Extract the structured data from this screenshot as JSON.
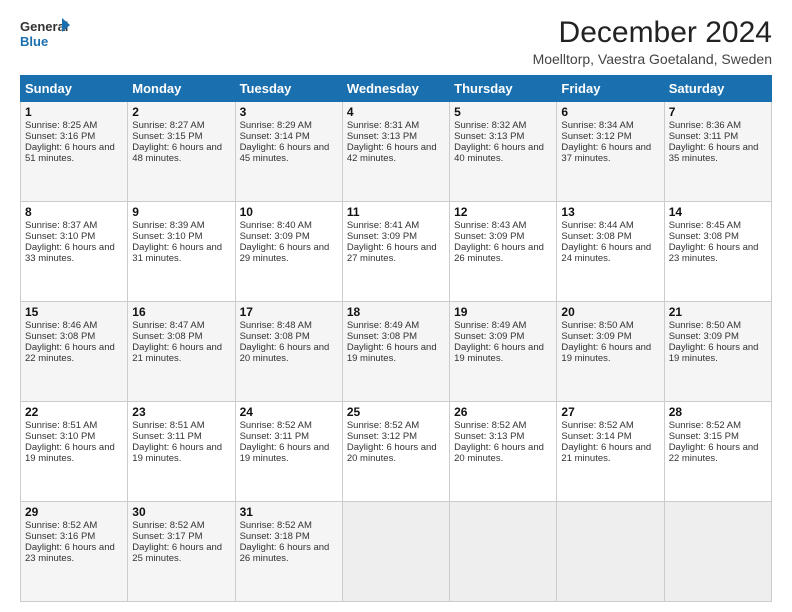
{
  "logo": {
    "line1": "General",
    "line2": "Blue"
  },
  "title": "December 2024",
  "subtitle": "Moelltorp, Vaestra Goetaland, Sweden",
  "days_header": [
    "Sunday",
    "Monday",
    "Tuesday",
    "Wednesday",
    "Thursday",
    "Friday",
    "Saturday"
  ],
  "weeks": [
    [
      {
        "day": "1",
        "sunrise": "Sunrise: 8:25 AM",
        "sunset": "Sunset: 3:16 PM",
        "daylight": "Daylight: 6 hours and 51 minutes."
      },
      {
        "day": "2",
        "sunrise": "Sunrise: 8:27 AM",
        "sunset": "Sunset: 3:15 PM",
        "daylight": "Daylight: 6 hours and 48 minutes."
      },
      {
        "day": "3",
        "sunrise": "Sunrise: 8:29 AM",
        "sunset": "Sunset: 3:14 PM",
        "daylight": "Daylight: 6 hours and 45 minutes."
      },
      {
        "day": "4",
        "sunrise": "Sunrise: 8:31 AM",
        "sunset": "Sunset: 3:13 PM",
        "daylight": "Daylight: 6 hours and 42 minutes."
      },
      {
        "day": "5",
        "sunrise": "Sunrise: 8:32 AM",
        "sunset": "Sunset: 3:13 PM",
        "daylight": "Daylight: 6 hours and 40 minutes."
      },
      {
        "day": "6",
        "sunrise": "Sunrise: 8:34 AM",
        "sunset": "Sunset: 3:12 PM",
        "daylight": "Daylight: 6 hours and 37 minutes."
      },
      {
        "day": "7",
        "sunrise": "Sunrise: 8:36 AM",
        "sunset": "Sunset: 3:11 PM",
        "daylight": "Daylight: 6 hours and 35 minutes."
      }
    ],
    [
      {
        "day": "8",
        "sunrise": "Sunrise: 8:37 AM",
        "sunset": "Sunset: 3:10 PM",
        "daylight": "Daylight: 6 hours and 33 minutes."
      },
      {
        "day": "9",
        "sunrise": "Sunrise: 8:39 AM",
        "sunset": "Sunset: 3:10 PM",
        "daylight": "Daylight: 6 hours and 31 minutes."
      },
      {
        "day": "10",
        "sunrise": "Sunrise: 8:40 AM",
        "sunset": "Sunset: 3:09 PM",
        "daylight": "Daylight: 6 hours and 29 minutes."
      },
      {
        "day": "11",
        "sunrise": "Sunrise: 8:41 AM",
        "sunset": "Sunset: 3:09 PM",
        "daylight": "Daylight: 6 hours and 27 minutes."
      },
      {
        "day": "12",
        "sunrise": "Sunrise: 8:43 AM",
        "sunset": "Sunset: 3:09 PM",
        "daylight": "Daylight: 6 hours and 26 minutes."
      },
      {
        "day": "13",
        "sunrise": "Sunrise: 8:44 AM",
        "sunset": "Sunset: 3:08 PM",
        "daylight": "Daylight: 6 hours and 24 minutes."
      },
      {
        "day": "14",
        "sunrise": "Sunrise: 8:45 AM",
        "sunset": "Sunset: 3:08 PM",
        "daylight": "Daylight: 6 hours and 23 minutes."
      }
    ],
    [
      {
        "day": "15",
        "sunrise": "Sunrise: 8:46 AM",
        "sunset": "Sunset: 3:08 PM",
        "daylight": "Daylight: 6 hours and 22 minutes."
      },
      {
        "day": "16",
        "sunrise": "Sunrise: 8:47 AM",
        "sunset": "Sunset: 3:08 PM",
        "daylight": "Daylight: 6 hours and 21 minutes."
      },
      {
        "day": "17",
        "sunrise": "Sunrise: 8:48 AM",
        "sunset": "Sunset: 3:08 PM",
        "daylight": "Daylight: 6 hours and 20 minutes."
      },
      {
        "day": "18",
        "sunrise": "Sunrise: 8:49 AM",
        "sunset": "Sunset: 3:08 PM",
        "daylight": "Daylight: 6 hours and 19 minutes."
      },
      {
        "day": "19",
        "sunrise": "Sunrise: 8:49 AM",
        "sunset": "Sunset: 3:09 PM",
        "daylight": "Daylight: 6 hours and 19 minutes."
      },
      {
        "day": "20",
        "sunrise": "Sunrise: 8:50 AM",
        "sunset": "Sunset: 3:09 PM",
        "daylight": "Daylight: 6 hours and 19 minutes."
      },
      {
        "day": "21",
        "sunrise": "Sunrise: 8:50 AM",
        "sunset": "Sunset: 3:09 PM",
        "daylight": "Daylight: 6 hours and 19 minutes."
      }
    ],
    [
      {
        "day": "22",
        "sunrise": "Sunrise: 8:51 AM",
        "sunset": "Sunset: 3:10 PM",
        "daylight": "Daylight: 6 hours and 19 minutes."
      },
      {
        "day": "23",
        "sunrise": "Sunrise: 8:51 AM",
        "sunset": "Sunset: 3:11 PM",
        "daylight": "Daylight: 6 hours and 19 minutes."
      },
      {
        "day": "24",
        "sunrise": "Sunrise: 8:52 AM",
        "sunset": "Sunset: 3:11 PM",
        "daylight": "Daylight: 6 hours and 19 minutes."
      },
      {
        "day": "25",
        "sunrise": "Sunrise: 8:52 AM",
        "sunset": "Sunset: 3:12 PM",
        "daylight": "Daylight: 6 hours and 20 minutes."
      },
      {
        "day": "26",
        "sunrise": "Sunrise: 8:52 AM",
        "sunset": "Sunset: 3:13 PM",
        "daylight": "Daylight: 6 hours and 20 minutes."
      },
      {
        "day": "27",
        "sunrise": "Sunrise: 8:52 AM",
        "sunset": "Sunset: 3:14 PM",
        "daylight": "Daylight: 6 hours and 21 minutes."
      },
      {
        "day": "28",
        "sunrise": "Sunrise: 8:52 AM",
        "sunset": "Sunset: 3:15 PM",
        "daylight": "Daylight: 6 hours and 22 minutes."
      }
    ],
    [
      {
        "day": "29",
        "sunrise": "Sunrise: 8:52 AM",
        "sunset": "Sunset: 3:16 PM",
        "daylight": "Daylight: 6 hours and 23 minutes."
      },
      {
        "day": "30",
        "sunrise": "Sunrise: 8:52 AM",
        "sunset": "Sunset: 3:17 PM",
        "daylight": "Daylight: 6 hours and 25 minutes."
      },
      {
        "day": "31",
        "sunrise": "Sunrise: 8:52 AM",
        "sunset": "Sunset: 3:18 PM",
        "daylight": "Daylight: 6 hours and 26 minutes."
      },
      null,
      null,
      null,
      null
    ]
  ]
}
